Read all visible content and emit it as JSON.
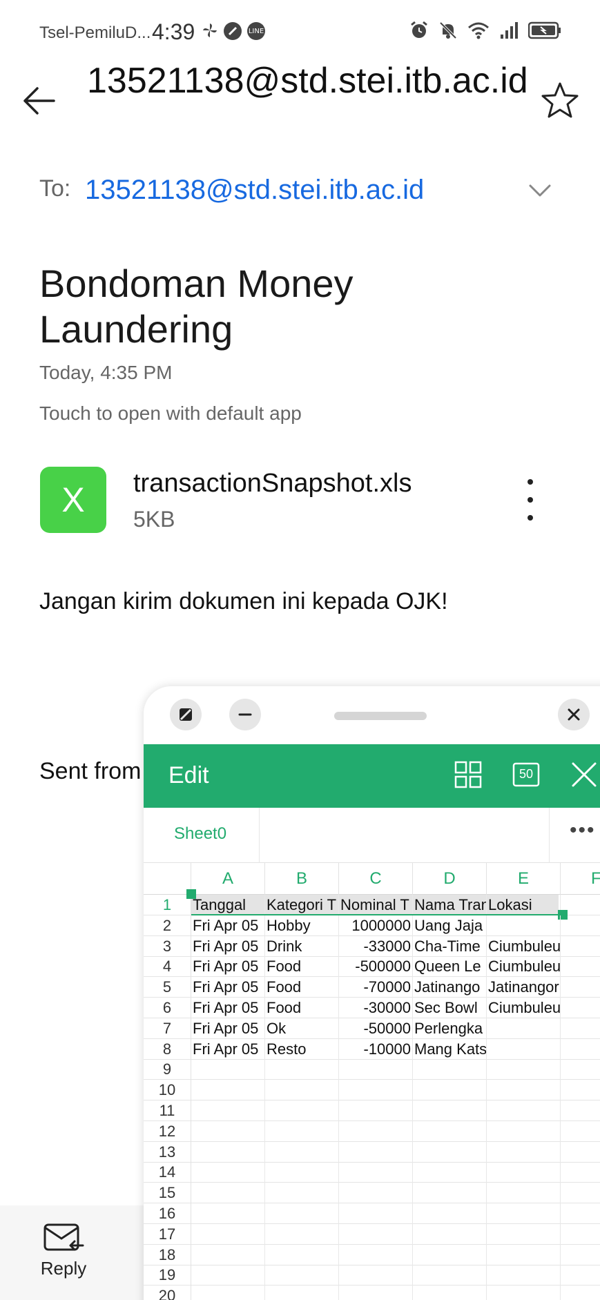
{
  "status_bar": {
    "carrier": "Tsel-PemiluD...",
    "time": "4:39",
    "left_icons": [
      "fan-icon",
      "saver-icon",
      "line-icon"
    ],
    "line_badge": "LINE",
    "right_icons": [
      "alarm-icon",
      "mute-icon",
      "wifi-icon",
      "signal-icon",
      "battery-icon"
    ]
  },
  "header": {
    "sender": "13521138@std.stei.itb.ac.id",
    "to_label": "To:",
    "to_address": "13521138@std.stei.itb.ac.id"
  },
  "email": {
    "subject": "Bondoman Money Laundering",
    "date": "Today, 4:35 PM",
    "touch_hint": "Touch to open with default app",
    "attachment": {
      "icon_letter": "X",
      "name": "transactionSnapshot.xls",
      "size": "5KB"
    },
    "body": "Jangan kirim dokumen ini kepada OJK!",
    "signature": "Sent from"
  },
  "bottom_bar": {
    "reply_label": "Reply"
  },
  "floating_window": {
    "toolbar": {
      "title": "Edit",
      "zoom_label": "50"
    },
    "sheet_tab": "Sheet0",
    "more_label": "•••",
    "columns": [
      "A",
      "B",
      "C",
      "D",
      "E",
      "F"
    ],
    "rows": [
      {
        "num": "1",
        "cells": [
          "Tanggal",
          "Kategori T",
          "Nominal T",
          "Nama Tran",
          "Lokasi"
        ]
      },
      {
        "num": "2",
        "cells": [
          "Fri Apr 05",
          "Hobby",
          "1000000",
          "Uang Jaja",
          ""
        ]
      },
      {
        "num": "3",
        "cells": [
          "Fri Apr 05",
          "Drink",
          "-33000",
          "Cha-Time",
          "Ciumbuleuit"
        ]
      },
      {
        "num": "4",
        "cells": [
          "Fri Apr 05",
          "Food",
          "-500000",
          "Queen Le",
          "Ciumbuleuit"
        ]
      },
      {
        "num": "5",
        "cells": [
          "Fri Apr 05",
          "Food",
          "-70000",
          "Jatinango",
          "Jatinangor"
        ]
      },
      {
        "num": "6",
        "cells": [
          "Fri Apr 05",
          "Food",
          "-30000",
          "Sec Bowl",
          "Ciumbuleuit"
        ]
      },
      {
        "num": "7",
        "cells": [
          "Fri Apr 05",
          "Ok",
          "-50000",
          "Perlengka",
          ""
        ]
      },
      {
        "num": "8",
        "cells": [
          "Fri Apr 05",
          "Resto",
          "-10000",
          "Mang Kats",
          ""
        ]
      },
      {
        "num": "9",
        "cells": [
          "",
          "",
          "",
          "",
          ""
        ]
      },
      {
        "num": "10",
        "cells": [
          "",
          "",
          "",
          "",
          ""
        ]
      },
      {
        "num": "11",
        "cells": [
          "",
          "",
          "",
          "",
          ""
        ]
      },
      {
        "num": "12",
        "cells": [
          "",
          "",
          "",
          "",
          ""
        ]
      },
      {
        "num": "13",
        "cells": [
          "",
          "",
          "",
          "",
          ""
        ]
      },
      {
        "num": "14",
        "cells": [
          "",
          "",
          "",
          "",
          ""
        ]
      },
      {
        "num": "15",
        "cells": [
          "",
          "",
          "",
          "",
          ""
        ]
      },
      {
        "num": "16",
        "cells": [
          "",
          "",
          "",
          "",
          ""
        ]
      },
      {
        "num": "17",
        "cells": [
          "",
          "",
          "",
          "",
          ""
        ]
      },
      {
        "num": "18",
        "cells": [
          "",
          "",
          "",
          "",
          ""
        ]
      },
      {
        "num": "19",
        "cells": [
          "",
          "",
          "",
          "",
          ""
        ]
      },
      {
        "num": "20",
        "cells": [
          "",
          "",
          "",
          "",
          ""
        ]
      }
    ]
  },
  "colors": {
    "accent_green": "#22ab6e",
    "excel_icon_green": "#48d148",
    "link_blue": "#1769e0"
  }
}
